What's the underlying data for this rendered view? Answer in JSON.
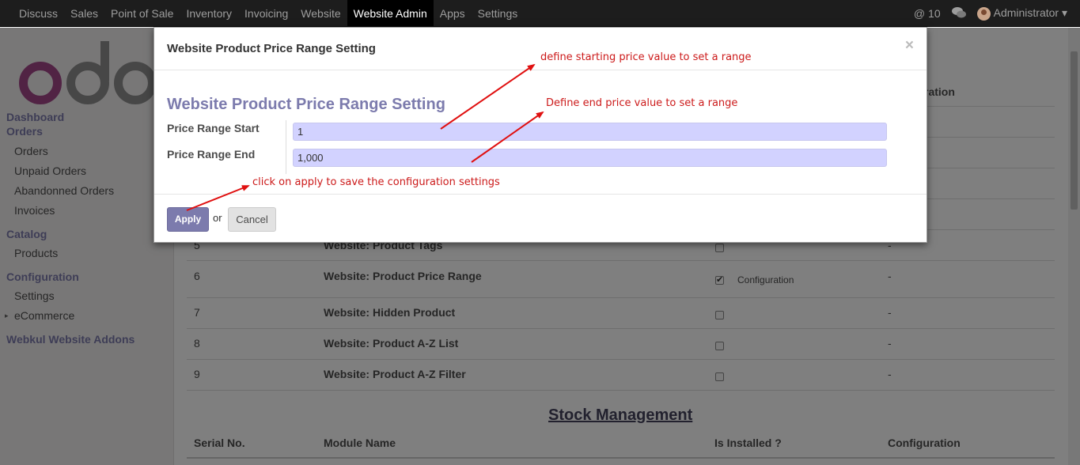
{
  "topbar": {
    "menu": [
      "Discuss",
      "Sales",
      "Point of Sale",
      "Inventory",
      "Invoicing",
      "Website",
      "Website Admin",
      "Apps",
      "Settings"
    ],
    "active": "Website Admin",
    "notifications": "10",
    "user": "Administrator"
  },
  "sidebar": {
    "sections": [
      {
        "title": "Dashboard",
        "items": []
      },
      {
        "title": "Orders",
        "items": [
          "Orders",
          "Unpaid Orders",
          "Abandonned Orders",
          "Invoices"
        ]
      },
      {
        "title": "Catalog",
        "items": [
          "Products"
        ]
      },
      {
        "title": "Configuration",
        "items": [
          "Settings",
          "eCommerce"
        ]
      },
      {
        "title": "Webkul Website Addons",
        "items": []
      }
    ]
  },
  "main": {
    "header_partial": "ration",
    "rows": [
      {
        "serial": "5",
        "module": "Website: Product Tags",
        "installed": false,
        "config": "-"
      },
      {
        "serial": "6",
        "module": "Website: Product Price Range",
        "installed": true,
        "config_link": "Configuration",
        "config": "-"
      },
      {
        "serial": "7",
        "module": "Website: Hidden Product",
        "installed": false,
        "config": "-"
      },
      {
        "serial": "8",
        "module": "Website: Product A-Z List",
        "installed": false,
        "config": "-"
      },
      {
        "serial": "9",
        "module": "Website: Product A-Z Filter",
        "installed": false,
        "config": "-"
      }
    ],
    "section_title": "Stock Management",
    "table_headers": [
      "Serial No.",
      "Module Name",
      "Is Installed ?",
      "Configuration"
    ]
  },
  "modal": {
    "title": "Website Product Price Range Setting",
    "close": "×",
    "form_title": "Website Product Price Range Setting",
    "fields": [
      {
        "label": "Price Range Start",
        "value": "1"
      },
      {
        "label": "Price Range End",
        "value": "1,000"
      }
    ],
    "apply_label": "Apply",
    "or_text": "or",
    "cancel_label": "Cancel"
  },
  "annotations": {
    "start_note": "define starting price value to set a range",
    "end_note": "Define end price value to set a range",
    "apply_note": "click on apply to save the configuration settings"
  },
  "colors": {
    "accent": "#7c7bad",
    "annotation": "#cc1a1a",
    "input_bg": "#d2d2ff"
  }
}
